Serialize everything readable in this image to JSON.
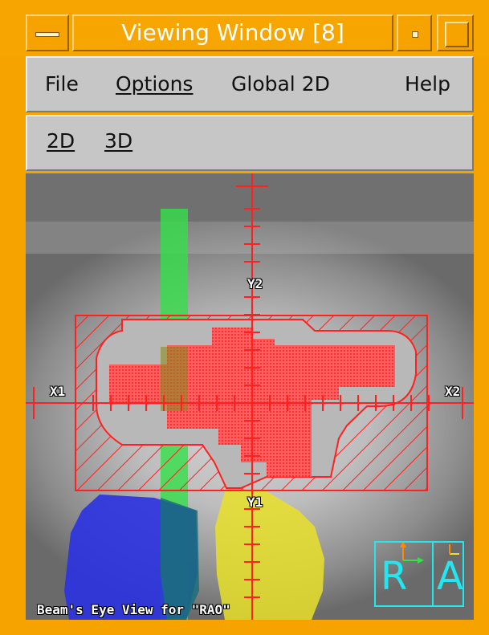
{
  "window": {
    "title": "Viewing Window [8]"
  },
  "menubar": {
    "items": [
      {
        "label": "File"
      },
      {
        "label": "Options",
        "mnemonic": "O"
      },
      {
        "label": "Global 2D"
      },
      {
        "label": "Help"
      }
    ]
  },
  "toolbar": {
    "items": [
      {
        "label": "2D"
      },
      {
        "label": "3D"
      }
    ]
  },
  "view": {
    "caption": "Beam's Eye View for \"RAO\"",
    "axis_labels": {
      "x1": "X1",
      "x2": "X2",
      "y1": "Y1",
      "y2": "Y2"
    },
    "orientation": {
      "left_letter": "R",
      "right_letter": "A"
    },
    "colors": {
      "field": "#ff2020",
      "green_structure": "#35e04a",
      "blue_structure": "#2a32e0",
      "yellow_structure": "#e8e02a",
      "orientation_box": "#22e6f0"
    },
    "icons": [
      "window-menu-icon",
      "minimize-icon",
      "maximize-icon"
    ]
  }
}
